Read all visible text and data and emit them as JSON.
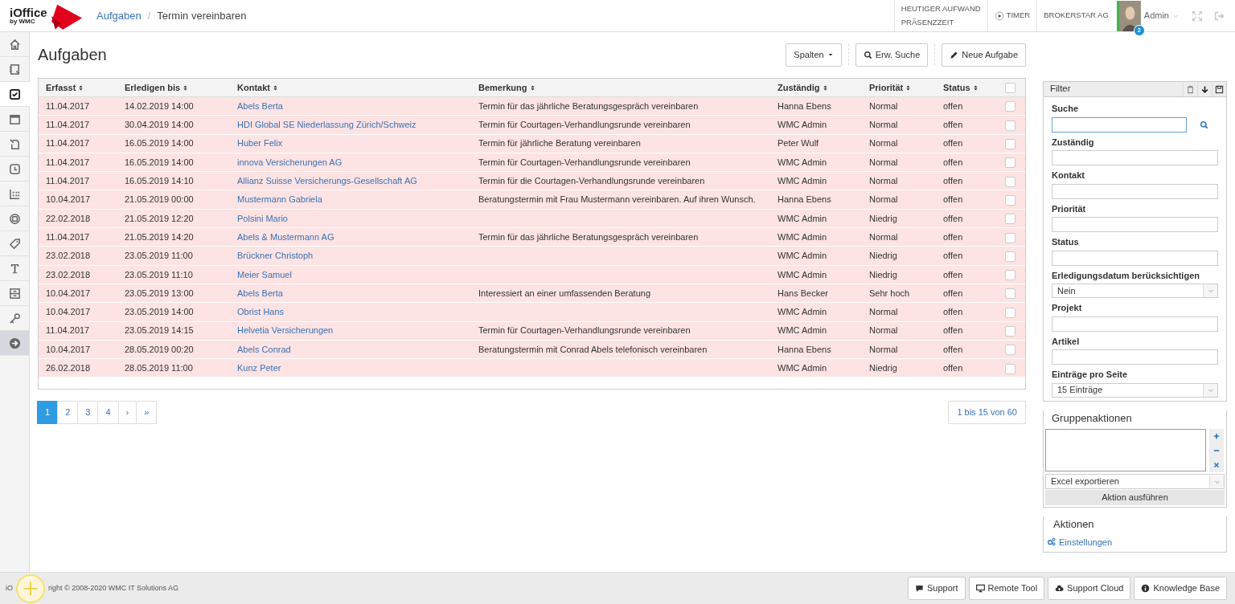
{
  "logo": {
    "title": "iOffice",
    "subtitle": "by WMC"
  },
  "breadcrumb": [
    {
      "label": "Aufgaben",
      "link": true
    },
    {
      "label": "Termin vereinbaren",
      "link": false
    }
  ],
  "breadcrumb_separator": "/",
  "header": {
    "effort": "HEUTIGER AUFWAND",
    "presence": "PRÄSENZZEIT",
    "timer": "TIMER",
    "company": "BROKERSTAR AG",
    "user": "Admin",
    "notifications": "2"
  },
  "sidebar": {
    "items": [
      {
        "selected": false
      },
      {
        "selected": false
      },
      {
        "selected": true
      },
      {
        "selected": false
      },
      {
        "selected": false
      },
      {
        "selected": false
      },
      {
        "selected": false
      },
      {
        "selected": false
      },
      {
        "selected": false
      },
      {
        "selected": false
      },
      {
        "selected": false
      },
      {
        "selected": false
      },
      {
        "selected": false,
        "kind": "toggle"
      }
    ]
  },
  "page_title": "Aufgaben",
  "toolbar": [
    {
      "label": "Spalten",
      "kind": "dropdown"
    },
    {
      "label": "Erw. Suche",
      "kind": "search"
    },
    {
      "label": "Neue Aufgabe",
      "kind": "new"
    }
  ],
  "table": {
    "columns": [
      "Erfasst",
      "Erledigen bis",
      "Kontakt",
      "Bemerkung",
      "Zuständig",
      "Priorität",
      "Status"
    ],
    "select_all_checked": false,
    "rows": [
      {
        "erfasst": "11.04.2017",
        "erledigen": "14.02.2019 14:00",
        "kontakt": "Abels Berta",
        "bemerkung": "Termin für das jährliche Beratungsgespräch vereinbaren",
        "zustaendig": "Hanna Ebens",
        "prioritaet": "Normal",
        "status": "offen",
        "checked": false
      },
      {
        "erfasst": "11.04.2017",
        "erledigen": "30.04.2019 14:00",
        "kontakt": "HDI Global SE Niederlassung Zürich/Schweiz",
        "bemerkung": "Termin für Courtagen-Verhandlungsrunde vereinbaren",
        "zustaendig": "WMC Admin",
        "prioritaet": "Normal",
        "status": "offen",
        "checked": false
      },
      {
        "erfasst": "11.04.2017",
        "erledigen": "16.05.2019 14:00",
        "kontakt": "Huber Felix",
        "bemerkung": "Termin für jährliche Beratung vereinbaren",
        "zustaendig": "Peter Wulf",
        "prioritaet": "Normal",
        "status": "offen",
        "checked": false
      },
      {
        "erfasst": "11.04.2017",
        "erledigen": "16.05.2019 14:00",
        "kontakt": "innova Versicherungen AG",
        "bemerkung": "Termin für Courtagen-Verhandlungsrunde vereinbaren",
        "zustaendig": "WMC Admin",
        "prioritaet": "Normal",
        "status": "offen",
        "checked": false
      },
      {
        "erfasst": "11.04.2017",
        "erledigen": "16.05.2019 14:10",
        "kontakt": "Allianz Suisse Versicherungs-Gesellschaft AG",
        "bemerkung": "Termin für die Courtagen-Verhandlungsrunde vereinbaren",
        "zustaendig": "WMC Admin",
        "prioritaet": "Normal",
        "status": "offen",
        "checked": false
      },
      {
        "erfasst": "10.04.2017",
        "erledigen": "21.05.2019 00:00",
        "kontakt": "Mustermann Gabriela",
        "bemerkung": "Beratungstermin mit Frau Mustermann vereinbaren. Auf ihren Wunsch.",
        "zustaendig": "Hanna Ebens",
        "prioritaet": "Normal",
        "status": "offen",
        "checked": false
      },
      {
        "erfasst": "22.02.2018",
        "erledigen": "21.05.2019 12:20",
        "kontakt": "Polsini Mario",
        "bemerkung": "",
        "zustaendig": "WMC Admin",
        "prioritaet": "Niedrig",
        "status": "offen",
        "checked": false
      },
      {
        "erfasst": "11.04.2017",
        "erledigen": "21.05.2019 14:20",
        "kontakt": "Abels & Mustermann AG",
        "bemerkung": "Termin für das jährliche Beratungsgespräch vereinbaren",
        "zustaendig": "WMC Admin",
        "prioritaet": "Normal",
        "status": "offen",
        "checked": false
      },
      {
        "erfasst": "23.02.2018",
        "erledigen": "23.05.2019 11:00",
        "kontakt": "Brückner Christoph",
        "bemerkung": "",
        "zustaendig": "WMC Admin",
        "prioritaet": "Niedrig",
        "status": "offen",
        "checked": false
      },
      {
        "erfasst": "23.02.2018",
        "erledigen": "23.05.2019 11:10",
        "kontakt": "Meier Samuel",
        "bemerkung": "",
        "zustaendig": "WMC Admin",
        "prioritaet": "Niedrig",
        "status": "offen",
        "checked": false
      },
      {
        "erfasst": "10.04.2017",
        "erledigen": "23.05.2019 13:00",
        "kontakt": "Abels Berta",
        "bemerkung": "Interessiert an einer umfassenden Beratung",
        "zustaendig": "Hans Becker",
        "prioritaet": "Sehr hoch",
        "status": "offen",
        "checked": false
      },
      {
        "erfasst": "10.04.2017",
        "erledigen": "23.05.2019 14:00",
        "kontakt": "Obrist Hans",
        "bemerkung": "",
        "zustaendig": "WMC Admin",
        "prioritaet": "Normal",
        "status": "offen",
        "checked": false
      },
      {
        "erfasst": "11.04.2017",
        "erledigen": "23.05.2019 14:15",
        "kontakt": "Helvetia Versicherungen",
        "bemerkung": "Termin für Courtagen-Verhandlungsrunde vereinbaren",
        "zustaendig": "WMC Admin",
        "prioritaet": "Normal",
        "status": "offen",
        "checked": false
      },
      {
        "erfasst": "10.04.2017",
        "erledigen": "28.05.2019 00:20",
        "kontakt": "Abels Conrad",
        "bemerkung": "Beratungstermin mit Conrad Abels telefonisch vereinbaren",
        "zustaendig": "Hanna Ebens",
        "prioritaet": "Normal",
        "status": "offen",
        "checked": false
      },
      {
        "erfasst": "26.02.2018",
        "erledigen": "28.05.2019 11:00",
        "kontakt": "Kunz Peter",
        "bemerkung": "",
        "zustaendig": "WMC Admin",
        "prioritaet": "Niedrig",
        "status": "offen",
        "checked": false
      }
    ]
  },
  "pagination": [
    {
      "label": "1",
      "selected": true
    },
    {
      "label": "2",
      "selected": false
    },
    {
      "label": "3",
      "selected": false
    },
    {
      "label": "4",
      "selected": false
    },
    {
      "label": "›",
      "selected": false
    },
    {
      "label": "»",
      "selected": false
    }
  ],
  "page_info": "1 bis 15 von 60",
  "filter": {
    "title": "Filter",
    "fields": [
      {
        "label": "Suche",
        "kind": "search"
      },
      {
        "label": "Zuständig",
        "kind": "text"
      },
      {
        "label": "Kontakt",
        "kind": "text"
      },
      {
        "label": "Priorität",
        "kind": "text"
      },
      {
        "label": "Status",
        "kind": "text"
      },
      {
        "label": "Erledigungsdatum berücksichtigen",
        "kind": "select",
        "value": "Nein"
      },
      {
        "label": "Projekt",
        "kind": "text"
      },
      {
        "label": "Artikel",
        "kind": "text"
      },
      {
        "label": "Einträge pro Seite",
        "kind": "select",
        "value": "15 Einträge"
      }
    ]
  },
  "group_actions": {
    "title": "Gruppenaktionen",
    "action": "Excel exportieren",
    "run": "Aktion ausführen"
  },
  "actions": {
    "title": "Aktionen",
    "links": [
      "Einstellungen"
    ]
  },
  "footer": {
    "text_parts": [
      "iO",
      "right © 2008-2020 WMC IT Solutions AG"
    ],
    "buttons": [
      {
        "label": "Support",
        "kind": "chat"
      },
      {
        "label": "Remote Tool",
        "kind": "monitor"
      },
      {
        "label": "Support Cloud",
        "kind": "cloud"
      },
      {
        "label": "Knowledge Base",
        "kind": "info"
      }
    ]
  }
}
